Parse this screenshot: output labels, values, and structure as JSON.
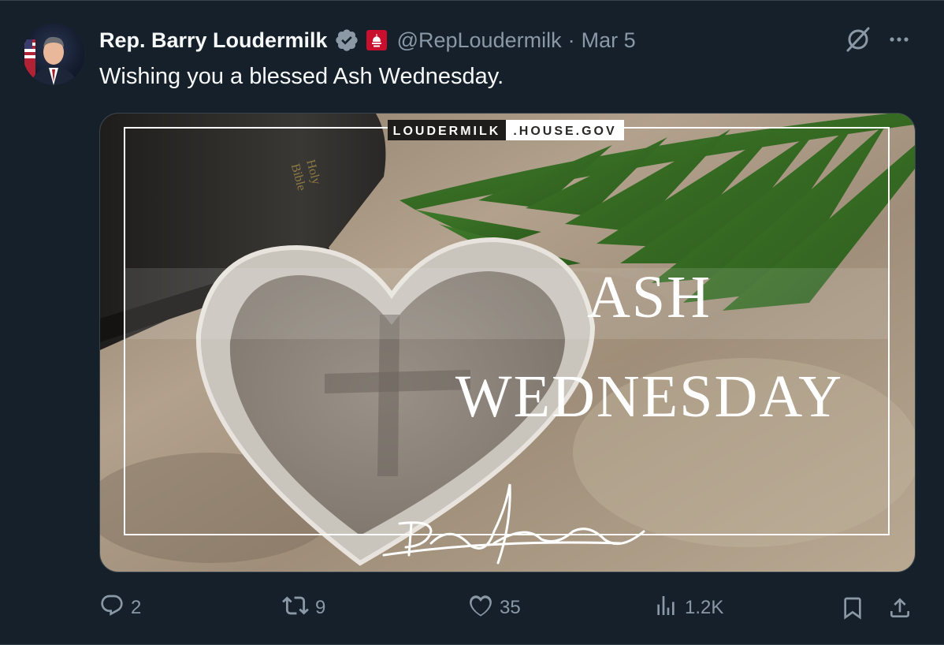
{
  "tweet": {
    "author_name": "Rep. Barry Loudermilk",
    "handle": "@RepLoudermilk",
    "separator": "·",
    "timestamp": "Mar 5",
    "text": "Wishing you a blessed Ash Wednesday."
  },
  "media": {
    "site_left": "LOUDERMILK",
    "site_right": ".HOUSE.GOV",
    "headline_line1": "ASH",
    "headline_line2": "WEDNESDAY",
    "book_text_1": "Holy",
    "book_text_2": "Bible"
  },
  "actions": {
    "replies": "2",
    "reposts": "9",
    "likes": "35",
    "views": "1.2K"
  },
  "colors": {
    "background": "#15202b",
    "text_primary": "#f7f9f9",
    "text_secondary": "#8b98a5",
    "verified_gray": "#8b98a5",
    "gov_badge": "#c8102e"
  },
  "icons": [
    "avatar",
    "verified-icon",
    "government-badge-icon",
    "grok-icon",
    "more-icon",
    "reply-icon",
    "repost-icon",
    "like-icon",
    "views-icon",
    "bookmark-icon",
    "share-icon"
  ]
}
